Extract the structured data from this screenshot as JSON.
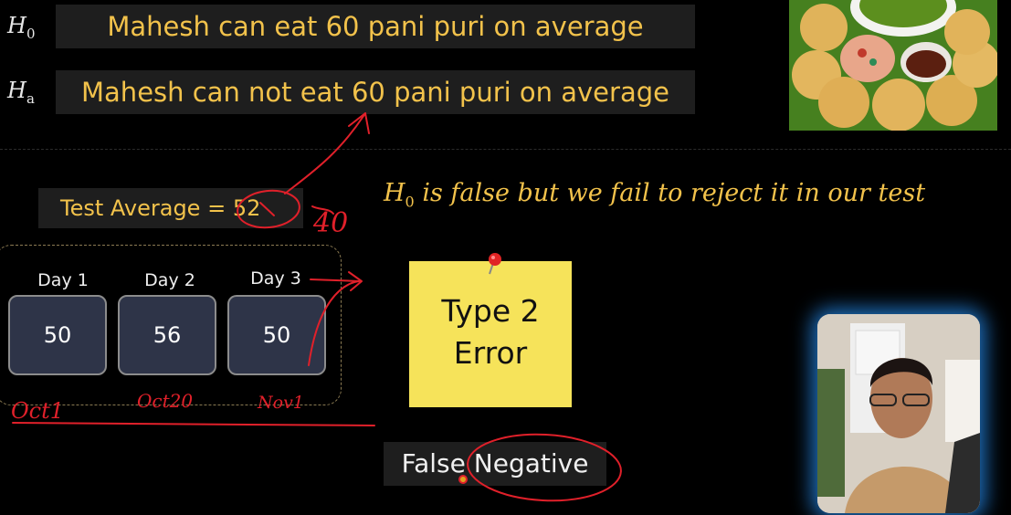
{
  "hypotheses": {
    "null": {
      "symbol": "H",
      "subscript": "0",
      "text": "Mahesh can eat 60 pani puri on average"
    },
    "alternative": {
      "symbol": "H",
      "subscript": "a",
      "text": "Mahesh can not eat 60 pani puri on average"
    }
  },
  "test_average": {
    "label": "Test Average = ",
    "value": "52"
  },
  "formula": {
    "symbol": "H",
    "subscript": "0",
    "text": " is false but we fail to reject it in our test"
  },
  "days": [
    {
      "label": "Day 1",
      "value": "50"
    },
    {
      "label": "Day 2",
      "value": "56"
    },
    {
      "label": "Day 3",
      "value": "50"
    }
  ],
  "sticky_note": {
    "line1": "Type 2",
    "line2": "Error"
  },
  "false_negative": {
    "word1": "False",
    "word2": "Negative"
  },
  "handwriting": {
    "annotation_40": "40",
    "day1_note": "Oct1",
    "day2_note": "Oct20",
    "day3_note": "Nov1"
  },
  "colors": {
    "accent_yellow": "#f2c24b",
    "ink_red": "#e0202a",
    "sticky_yellow": "#f6e35a",
    "card_fill": "#2e3448",
    "webcam_glow": "#2896ff"
  },
  "icons": {
    "pin": "pushpin-icon"
  }
}
